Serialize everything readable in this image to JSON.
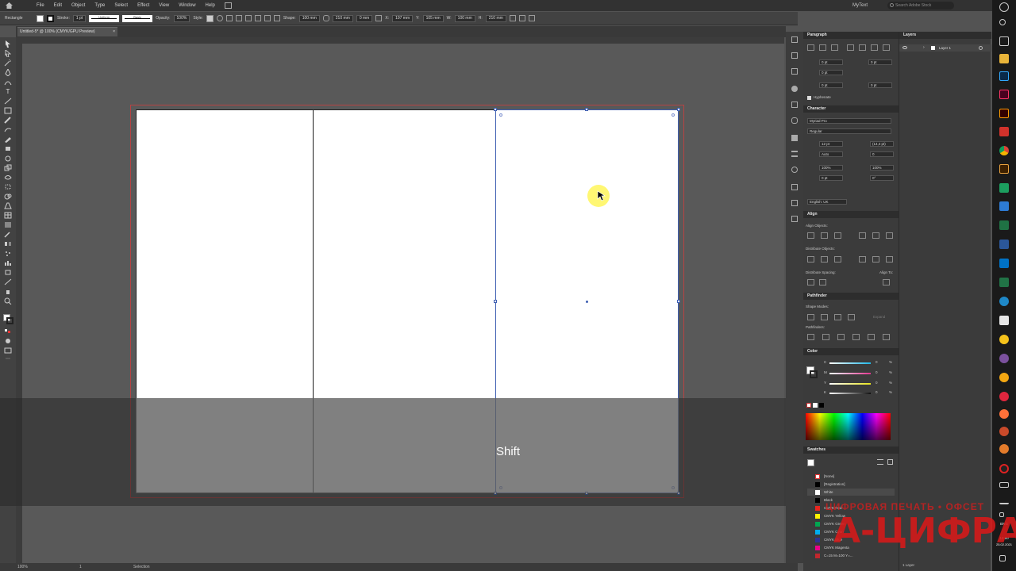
{
  "menu": {
    "items": [
      "File",
      "Edit",
      "Object",
      "Type",
      "Select",
      "Effect",
      "View",
      "Window",
      "Help"
    ],
    "workspace": "MyText",
    "search_placeholder": "Search Adobe Stock"
  },
  "control_bar": {
    "tool_name": "Rectangle",
    "stroke_label": "Stroke:",
    "stroke_weight": "1 pt",
    "profile_label": "Uniform",
    "brush_label": "Basic",
    "opacity_label": "Opacity:",
    "opacity_value": "100%",
    "style_label": "Style:",
    "shape_label": "Shape:",
    "width_value": "100 mm",
    "height_value": "210 mm",
    "corner_value": "0 mm",
    "x_label": "X:",
    "x_value": "197 mm",
    "y_label": "Y:",
    "y_value": "105 mm",
    "w_label": "W:",
    "w_value": "100 mm",
    "h_label": "H:",
    "h_value": "210 mm"
  },
  "document_tab": {
    "title": "Untitled-5* @ 100% (CMYK/GPU Preview)",
    "close": "×"
  },
  "overlay": {
    "key_pressed": "Shift"
  },
  "status_bar": {
    "zoom": "100%",
    "artboard": "1",
    "tool": "Selection"
  },
  "panels": {
    "paragraph": {
      "title": "Paragraph",
      "fields": [
        "0 pt",
        "0 pt",
        "0 pt",
        "0 pt",
        "0 pt"
      ],
      "hyphenate": "Hyphenate"
    },
    "character": {
      "title": "Character",
      "font": "Myriad Pro",
      "style": "Regular",
      "size": "12 pt",
      "leading": "(14,4 pt)",
      "kerning": "Auto",
      "tracking": "0",
      "scale_v": "100%",
      "scale_h": "100%",
      "baseline": "0 pt",
      "rotation": "0°",
      "language": "English: UK"
    },
    "align": {
      "title": "Align",
      "align_objects": "Align Objects:",
      "distribute_objects": "Distribute Objects:",
      "distribute_spacing": "Distribute Spacing:",
      "align_to": "Align To:"
    },
    "pathfinder": {
      "title": "Pathfinder",
      "shape_modes": "Shape Modes:",
      "pathfinders": "Pathfinders:",
      "expand": "Expand"
    },
    "color": {
      "title": "Color",
      "channels": [
        {
          "label": "C",
          "value": "0",
          "unit": "%",
          "color": "#1fb6e6"
        },
        {
          "label": "M",
          "value": "0",
          "unit": "%",
          "color": "#e0368f"
        },
        {
          "label": "Y",
          "value": "0",
          "unit": "%",
          "color": "#e6e21e"
        },
        {
          "label": "K",
          "value": "0",
          "unit": "%",
          "color": "#9a9a9a"
        }
      ]
    },
    "swatches": {
      "title": "Swatches",
      "items": [
        {
          "name": "[None]",
          "color": "#ffffff"
        },
        {
          "name": "[Registration]",
          "color": "#000000"
        },
        {
          "name": "White",
          "color": "#ffffff"
        },
        {
          "name": "Black",
          "color": "#000000"
        },
        {
          "name": "CMYK Red",
          "color": "#e8251f"
        },
        {
          "name": "CMYK Yellow",
          "color": "#fff200"
        },
        {
          "name": "CMYK Green",
          "color": "#00a651"
        },
        {
          "name": "CMYK Cyan",
          "color": "#00aeef"
        },
        {
          "name": "CMYK Blue",
          "color": "#2e3192"
        },
        {
          "name": "CMYK Magenta",
          "color": "#ec008c"
        },
        {
          "name": "C=15 M=100 Y=...",
          "color": "#c1272d"
        }
      ]
    }
  },
  "layers": {
    "title": "Layers",
    "items": [
      {
        "name": "Layer 1"
      }
    ],
    "footer": "1 Layer"
  },
  "taskbar": {
    "lang": "ENG",
    "time": "14:10",
    "date": "25.02.2021"
  },
  "watermark": {
    "top_line": "ЦИФРОВАЯ ПЕЧАТЬ • ОФСЕТ",
    "brand": "А-ЦИФРА"
  },
  "colors": {
    "selection": "#3f5fb2",
    "bleed": "#b64343",
    "cursor_highlight": "#fff000",
    "watermark": "#d71919"
  }
}
